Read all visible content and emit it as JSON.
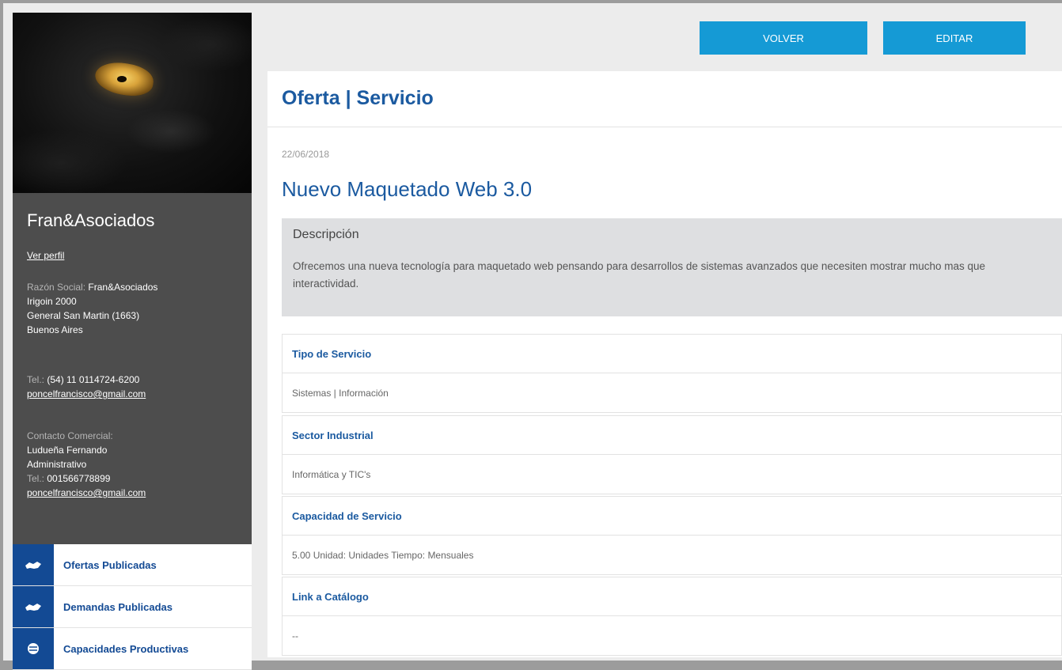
{
  "header": {
    "volver_label": "VOLVER",
    "editar_label": "EDITAR"
  },
  "sidebar": {
    "company_name": "Fran&Asociados",
    "ver_perfil": "Ver perfil",
    "razon_social_label": "Razón Social:",
    "razon_social": "Fran&Asociados",
    "address_line1": "Irigoin 2000",
    "address_line2": "General San Martin (1663)",
    "address_line3": "Buenos Aires",
    "tel_label": "Tel.:",
    "tel": "(54) 11 0114724-6200",
    "email": "poncelfrancisco@gmail.com",
    "contact_label": "Contacto Comercial:",
    "contact_name": "Ludueña Fernando",
    "contact_role": "Administrativo",
    "contact_tel_label": "Tel.:",
    "contact_tel": "001566778899",
    "contact_email": "poncelfrancisco@gmail.com",
    "nav": [
      {
        "label": "Ofertas Publicadas",
        "icon": "handshake-icon"
      },
      {
        "label": "Demandas Publicadas",
        "icon": "handshake-icon"
      },
      {
        "label": "Capacidades Productivas",
        "icon": "globe-icon"
      }
    ]
  },
  "main": {
    "page_title": "Oferta | Servicio",
    "date": "22/06/2018",
    "offer_title": "Nuevo Maquetado Web 3.0",
    "description_heading": "Descripción",
    "description_text": "Ofrecemos una nueva tecnología para maquetado web pensando para desarrollos de sistemas avanzados que necesiten mostrar mucho mas que interactividad.",
    "fields": [
      {
        "label": "Tipo de Servicio",
        "value": "Sistemas | Información"
      },
      {
        "label": "Sector Industrial",
        "value": "Informática y TIC's"
      },
      {
        "label": "Capacidad de Servicio",
        "value": "5.00 Unidad: Unidades Tiempo: Mensuales"
      },
      {
        "label": "Link a Catálogo",
        "value": "--"
      }
    ]
  },
  "colors": {
    "accent": "#159ad5",
    "title_blue": "#1b5aa0",
    "nav_blue": "#134a94",
    "sidebar_bg": "#4d4d4d"
  }
}
